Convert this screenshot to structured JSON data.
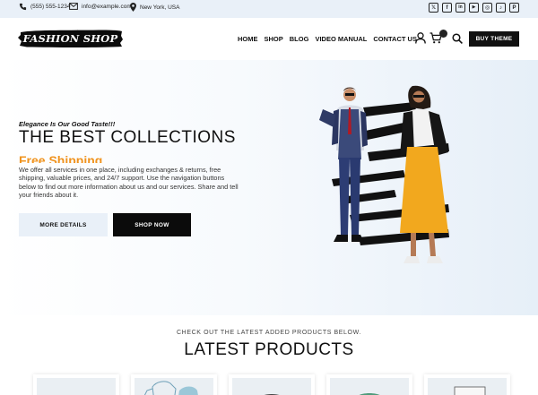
{
  "topbar": {
    "phone": "(555) 555-1234",
    "email": "info@example.com",
    "location": "New York, USA",
    "socials": [
      {
        "name": "x",
        "glyph": "𝕏"
      },
      {
        "name": "facebook",
        "glyph": "f"
      },
      {
        "name": "linkedin",
        "glyph": "in"
      },
      {
        "name": "youtube",
        "glyph": "▶"
      },
      {
        "name": "instagram",
        "glyph": "◎"
      },
      {
        "name": "tiktok",
        "glyph": "♪"
      },
      {
        "name": "pinterest",
        "glyph": "P"
      }
    ]
  },
  "header": {
    "logo": "FASHION SHOP",
    "nav": [
      "HOME",
      "SHOP",
      "BLOG",
      "VIDEO MANUAL",
      "CONTACT US"
    ],
    "icons": [
      "user-icon",
      "cart-icon",
      "search-icon"
    ],
    "buy_button": "BUY THEME"
  },
  "hero": {
    "tagline": "Elegance Is Our Good Taste!!!",
    "title": "THE BEST COLLECTIONS",
    "highlight": "Free Shipping",
    "description": "We offer all services in one place, including exchanges & returns, free shipping, valuable prices, and 24/7 support. Use the navigation buttons below to find out more information about us and our services. Share and tell your friends about it.",
    "details_button": "MORE DETAILS",
    "shop_button": "SHOP NOW"
  },
  "products": {
    "kicker": "CHECK OUT THE LATEST ADDED PRODUCTS BELOW.",
    "title": "LATEST PRODUCTS",
    "items": [
      {
        "image": "product-image-1"
      },
      {
        "image": "product-image-2"
      },
      {
        "image": "product-image-3"
      },
      {
        "image": "product-image-4"
      },
      {
        "image": "product-image-5"
      }
    ]
  },
  "colors": {
    "accent": "#f0931e",
    "dark": "#0b0b0b",
    "light_panel": "#e9f0f8"
  }
}
